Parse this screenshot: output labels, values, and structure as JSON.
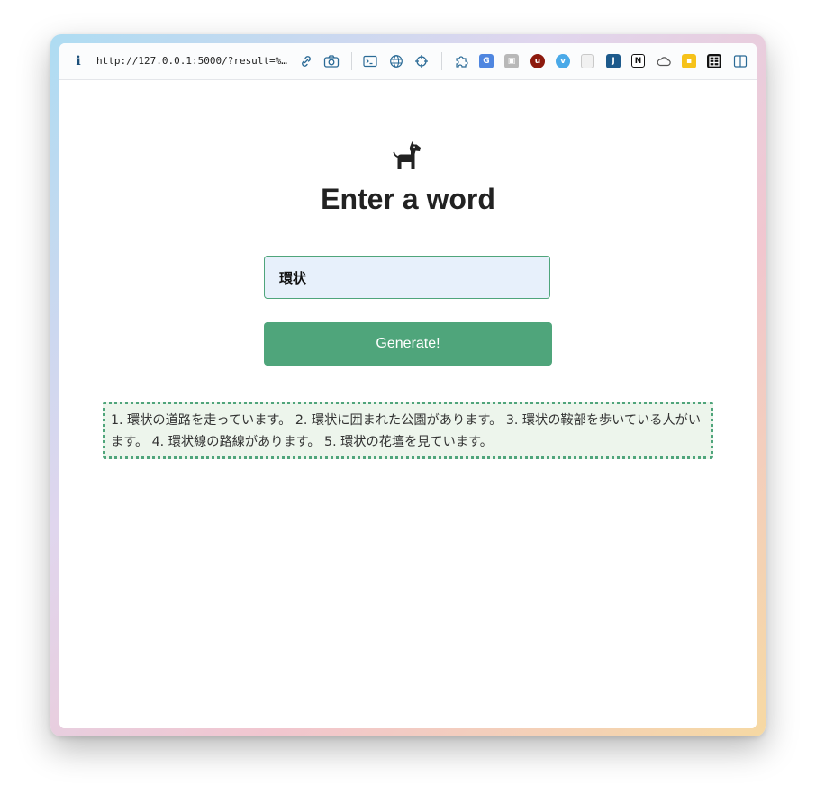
{
  "browser": {
    "info_icon": "i",
    "url": "http://127.0.0.1:5000/?result=%…",
    "toolbar_icons": [
      "link-icon",
      "camera-icon",
      "terminal-icon",
      "globe-icon",
      "crosshair-icon"
    ],
    "extensions": [
      "puzzle-extension-icon",
      "translate-extension-icon",
      "profile-extension-icon",
      "ublock-extension-icon",
      "vimeo-extension-icon",
      "page-extension-icon",
      "bookmark-extension-icon",
      "notion-extension-icon",
      "cloud-extension-icon",
      "note-extension-icon",
      "table-extension-icon",
      "sidebar-toggle-icon"
    ]
  },
  "page": {
    "logo": "dog-icon",
    "title": "Enter a word",
    "input_value": "環状",
    "button_label": "Generate!",
    "result_text": "1. 環状の道路を走っています。 2. 環状に囲まれた公園があります。 3. 環状の鞍部を歩いている人がいます。 4. 環状線の路線があります。 5. 環状の花壇を見ています。"
  },
  "colors": {
    "accent": "#4fa57b",
    "input_bg": "#e7f0fb",
    "result_bg": "#edf5ec",
    "title_text": "#222222"
  }
}
